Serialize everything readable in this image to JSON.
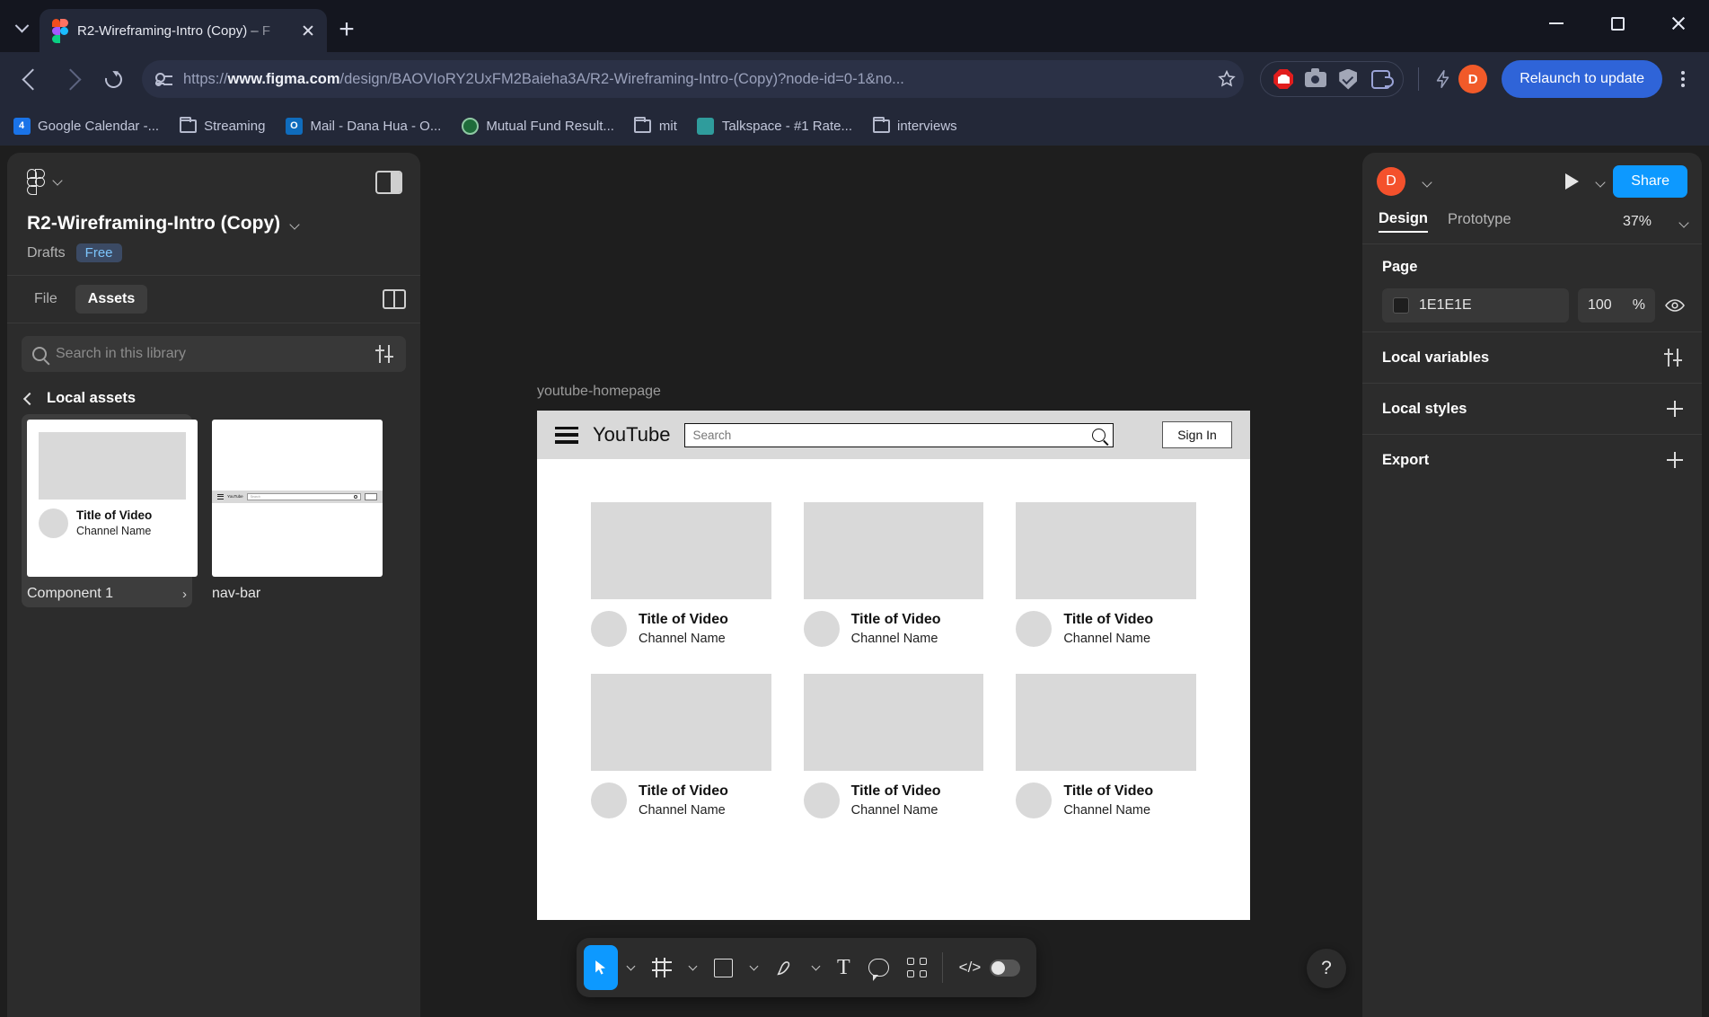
{
  "browser": {
    "tab": {
      "title": "R2-Wireframing-Intro (Copy) – F",
      "favicon": "figma-icon",
      "close": "×"
    },
    "newtab_label": "+",
    "window_controls": {
      "minimize": "minimize-icon",
      "maximize": "maximize-icon",
      "close": "close-icon"
    },
    "nav": {
      "back": "back-arrow-icon",
      "forward": "forward-arrow-icon",
      "reload": "reload-icon",
      "site_info": "site-settings-icon",
      "url_prefix": "https://",
      "url_domain": "www.figma.com",
      "url_rest": "/design/BAOVIoRY2UxFM2Baieha3A/R2-Wireframing-Intro-(Copy)?node-id=0-1&no...",
      "bookmark": "star-icon"
    },
    "extensions": [
      {
        "name": "adblock-icon"
      },
      {
        "name": "screenshot-camera-icon"
      },
      {
        "name": "shield-check-icon"
      },
      {
        "name": "extensions-puzzle-icon"
      }
    ],
    "flash_icon": "lightning-icon",
    "profile_initial": "D",
    "relaunch_label": "Relaunch to update",
    "menu": "browser-menu-icon",
    "bookmarks": [
      {
        "label": "Google Calendar -...",
        "icon": "calendar-icon",
        "glyph": "4"
      },
      {
        "label": "Streaming",
        "icon": "folder-icon",
        "glyph": ""
      },
      {
        "label": "Mail - Dana Hua - O...",
        "icon": "outlook-icon",
        "glyph": "O"
      },
      {
        "label": "Mutual Fund Result...",
        "icon": "mutualfund-icon",
        "glyph": ""
      },
      {
        "label": "mit",
        "icon": "folder-icon",
        "glyph": ""
      },
      {
        "label": "Talkspace - #1 Rate...",
        "icon": "talkspace-icon",
        "glyph": ""
      },
      {
        "label": "interviews",
        "icon": "folder-icon",
        "glyph": ""
      }
    ]
  },
  "figma": {
    "left_panel": {
      "logo": "figma-logo-icon",
      "panel_toggle": "toggle-panel-icon",
      "file_name": "R2-Wireframing-Intro (Copy)",
      "location": "Drafts",
      "plan_badge": "Free",
      "tabs": [
        {
          "label": "File",
          "active": false
        },
        {
          "label": "Assets",
          "active": true
        }
      ],
      "library_icon": "library-book-icon",
      "search_placeholder": "Search in this library",
      "filter_icon": "filter-sliders-icon",
      "breadcrumb_back": "back-chevron-icon",
      "breadcrumb_label": "Local assets",
      "assets": [
        {
          "name": "Component 1",
          "selected": true,
          "more": "›",
          "preview": {
            "title": "Title of Video",
            "channel": "Channel Name"
          }
        },
        {
          "name": "nav-bar",
          "selected": false,
          "preview": {
            "brand": "YouTube",
            "search_placeholder": "Search",
            "signin": "Sign In"
          }
        }
      ]
    },
    "canvas": {
      "frame_label": "youtube-homepage",
      "mockup": {
        "nav": {
          "menu_icon": "hamburger-menu-icon",
          "brand": "YouTube",
          "search_placeholder": "Search",
          "search_icon": "search-icon",
          "signin_label": "Sign In"
        },
        "videos": [
          {
            "title": "Title of Video",
            "channel": "Channel Name"
          },
          {
            "title": "Title of Video",
            "channel": "Channel Name"
          },
          {
            "title": "Title of Video",
            "channel": "Channel Name"
          },
          {
            "title": "Title of Video",
            "channel": "Channel Name"
          },
          {
            "title": "Title of Video",
            "channel": "Channel Name"
          },
          {
            "title": "Title of Video",
            "channel": "Channel Name"
          }
        ]
      }
    },
    "right_panel": {
      "avatar_initial": "D",
      "avatar_color": "#F4512C",
      "present_icon": "play-present-icon",
      "share_label": "Share",
      "share_color": "#0D99FF",
      "tabs": [
        {
          "label": "Design",
          "active": true
        },
        {
          "label": "Prototype",
          "active": false
        }
      ],
      "zoom": "37%",
      "page": {
        "title": "Page",
        "background_hex": "1E1E1E",
        "opacity": "100",
        "opacity_unit": "%",
        "visibility_icon": "eye-icon"
      },
      "sections": [
        {
          "title": "Local variables",
          "action": "variables-icon"
        },
        {
          "title": "Local styles",
          "action": "plus-icon"
        },
        {
          "title": "Export",
          "action": "plus-icon"
        }
      ]
    },
    "toolbar": {
      "tools": [
        {
          "name": "move-tool",
          "icon": "cursor-icon",
          "active": true,
          "has_chevron": true
        },
        {
          "name": "frame-tool",
          "icon": "frame-icon",
          "active": false,
          "has_chevron": true
        },
        {
          "name": "shape-tool",
          "icon": "rectangle-icon",
          "active": false,
          "has_chevron": true
        },
        {
          "name": "pen-tool",
          "icon": "pen-icon",
          "active": false,
          "has_chevron": true
        },
        {
          "name": "text-tool",
          "icon": "text-icon",
          "active": false,
          "has_chevron": false
        },
        {
          "name": "comment-tool",
          "icon": "comment-icon",
          "active": false,
          "has_chevron": false
        },
        {
          "name": "actions-tool",
          "icon": "plugins-icon",
          "active": false,
          "has_chevron": false
        }
      ],
      "dev_mode": {
        "icon": "code-icon",
        "toggle": "off"
      }
    },
    "help_label": "?"
  }
}
